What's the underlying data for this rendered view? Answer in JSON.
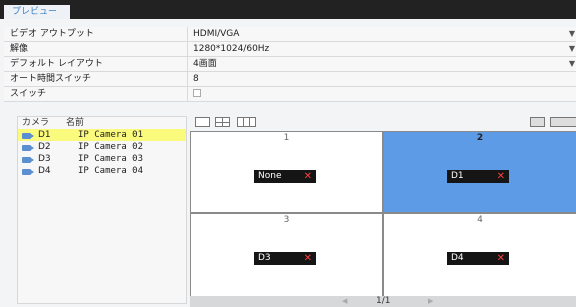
{
  "tab": {
    "label": "プレビュー"
  },
  "settings": [
    {
      "label": "ビデオ アウトプット",
      "value": "HDMI/VGA",
      "dropdown": true
    },
    {
      "label": "解像",
      "value": "1280*1024/60Hz",
      "dropdown": true
    },
    {
      "label": "デフォルト レイアウト",
      "value": "4画面",
      "dropdown": true
    },
    {
      "label": "オート時間スイッチ",
      "value": "8",
      "dropdown": false
    },
    {
      "label": "スイッチ",
      "value": "",
      "checkbox": true
    }
  ],
  "camera_list": {
    "header_camera": "カメラ",
    "header_name": "名前",
    "items": [
      {
        "id": "D1",
        "name": "IP Camera 01",
        "selected": true
      },
      {
        "id": "D2",
        "name": "IP Camera 02",
        "selected": false
      },
      {
        "id": "D3",
        "name": "IP Camera 03",
        "selected": false
      },
      {
        "id": "D4",
        "name": "IP Camera 04",
        "selected": false
      }
    ]
  },
  "grid": {
    "cells": [
      {
        "num": "1",
        "chip": "None",
        "selected": false
      },
      {
        "num": "2",
        "chip": "D1",
        "selected": true
      },
      {
        "num": "3",
        "chip": "D3",
        "selected": false
      },
      {
        "num": "4",
        "chip": "D4",
        "selected": false
      }
    ],
    "remove_glyph": "✕"
  },
  "pager": {
    "prev": "◀",
    "page": "1/1",
    "next": "▶"
  },
  "colors": {
    "selected_cell": "#5d9be6",
    "selected_row": "#fafa7c",
    "accent": "#3a82c4"
  }
}
